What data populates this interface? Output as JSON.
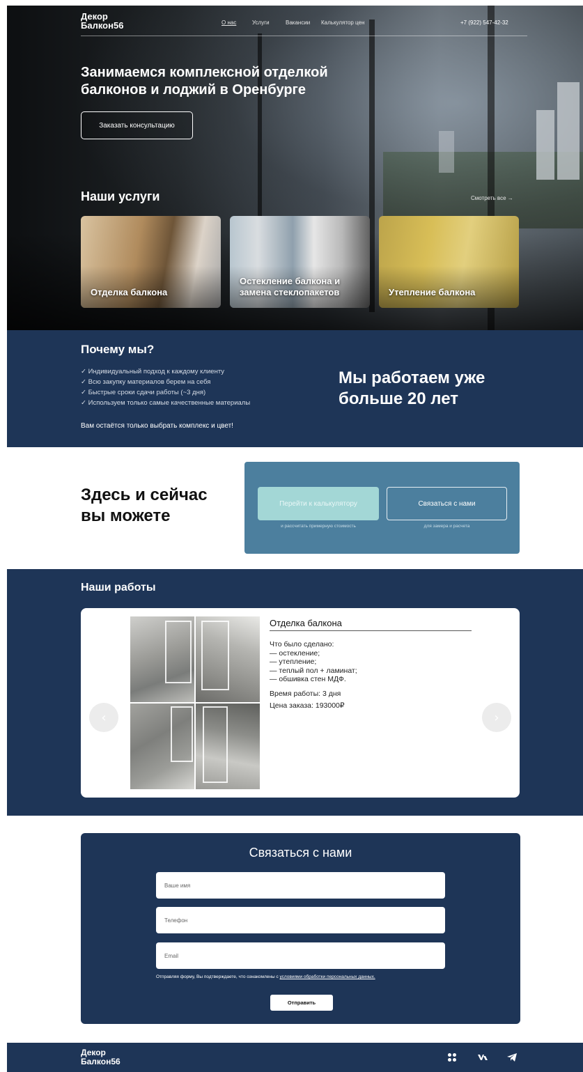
{
  "header": {
    "logo_line1": "Декор",
    "logo_line2": "Балкон56",
    "nav": [
      "О нас",
      "Услуги",
      "Вакансии",
      "Калькулятор цен"
    ],
    "phone": "+7 (922) 547-42-32"
  },
  "hero": {
    "title": "Занимаемся комплексной отделкой балконов и лоджий в Оренбурге",
    "consult_button": "Заказать консультацию"
  },
  "services": {
    "title": "Наши услуги",
    "see_all": "Смотреть все →",
    "cards": [
      "Отделка балкона",
      "Остекление балкона и замена стеклопакетов",
      "Утепление балкона"
    ]
  },
  "why": {
    "title": "Почему мы?",
    "items": [
      "Индивидуальный подход к каждому клиенту",
      "Всю закупку материалов берем на себя",
      "Быстрые сроки сдачи работы (~3 дня)",
      "Используем только самые качественные материалы"
    ],
    "note": "Вам остаётся только выбрать комплекс и цвет!",
    "years_line1": "Мы работаем уже",
    "years_line2": "больше 20 лет"
  },
  "cta": {
    "title_line1": "Здесь и сейчас",
    "title_line2": "вы можете",
    "calc_button": "Перейти к калькулятору",
    "calc_sub": "и рассчитать примерную стоимость",
    "contact_button": "Связаться с нами",
    "contact_sub": "для замера и расчета"
  },
  "works": {
    "title": "Наши работы",
    "item_title": "Отделка балкона",
    "done_label": "Что было сделано:",
    "done_items": [
      "— остекление;",
      "— утепление;",
      "— теплый пол + ламинат;",
      "— обшивка стен МДФ."
    ],
    "time": "Время работы: 3 дня",
    "price": "Цена заказа: 193000₽",
    "prev_icon": "chevron-left-icon",
    "next_icon": "chevron-right-icon"
  },
  "contact": {
    "title": "Связаться с нами",
    "name_placeholder": "Ваше имя",
    "phone_placeholder": "Телефон",
    "email_placeholder": "Email",
    "consent_text": "Отправляя форму, Вы подтверждаете,  что ознакомлены с ",
    "consent_link": "условиями обработки персональных данных.",
    "submit": "Отправить"
  },
  "footer": {
    "logo_line1": "Декор",
    "logo_line2": "Балкон56",
    "icons": [
      "dots-icon",
      "vk-icon",
      "telegram-icon"
    ]
  },
  "colors": {
    "navy": "#1e3557",
    "cta_panel": "#4c7f9e",
    "cta_button": "#a3d7d6"
  }
}
